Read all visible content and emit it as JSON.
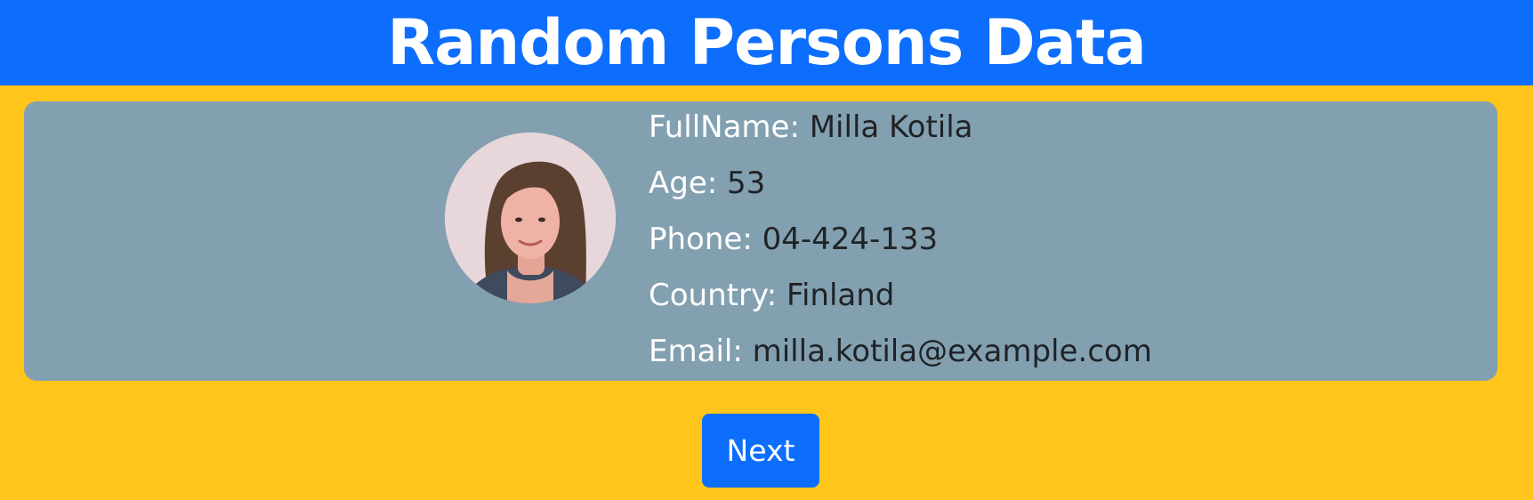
{
  "header": {
    "title": "Random Persons Data"
  },
  "person": {
    "full_name_label": "FullName:",
    "full_name": "Milla Kotila",
    "age_label": "Age:",
    "age": "53",
    "phone_label": "Phone:",
    "phone": "04-424-133",
    "country_label": "Country:",
    "country": "Finland",
    "email_label": "Email:",
    "email": "milla.kotila@example.com"
  },
  "controls": {
    "next_label": "Next"
  },
  "colors": {
    "page_background": "#ffc51b",
    "header_background": "#0d6efd",
    "card_background": "#83a0b0",
    "button_background": "#0d6efd"
  }
}
